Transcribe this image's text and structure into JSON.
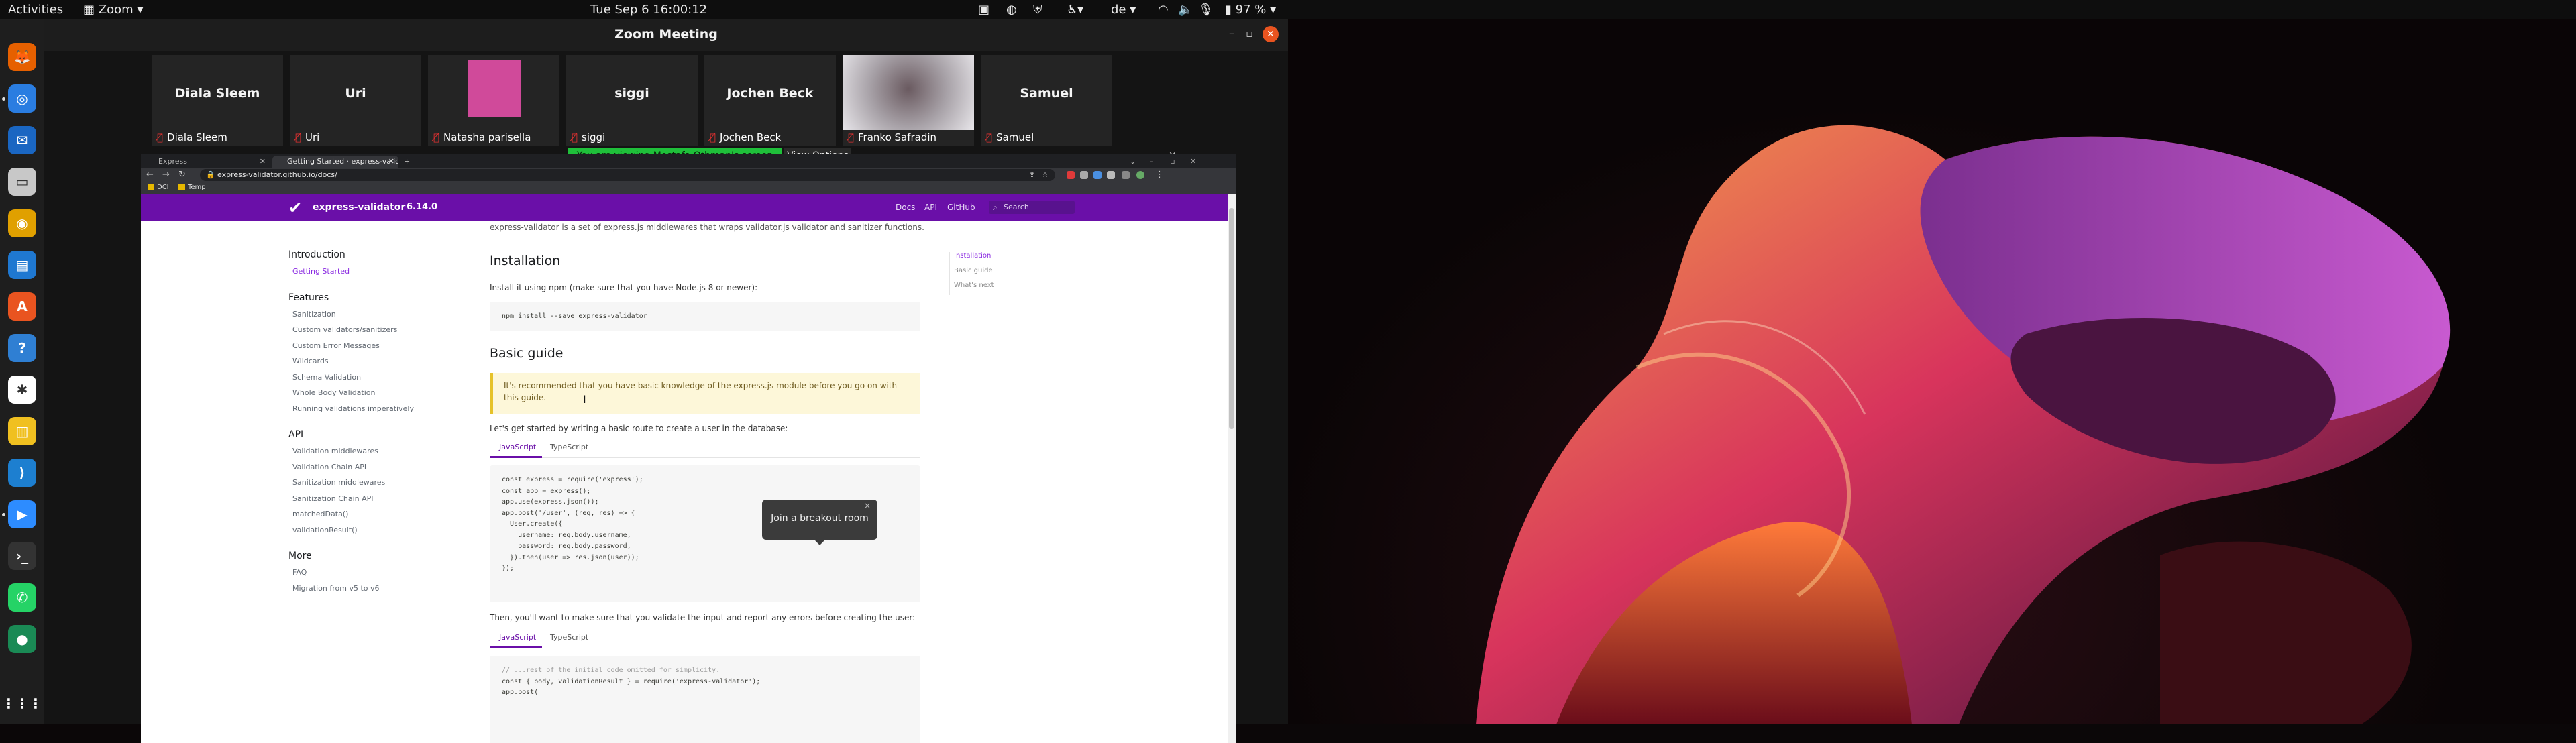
{
  "topbar": {
    "activities": "Activities",
    "app_menu": "Zoom",
    "clock": "Tue Sep 6  16:00:12",
    "keyboard_layout": "de",
    "battery": "97 %"
  },
  "dock": {
    "apps": [
      {
        "icon": "firefox-icon",
        "color": "#e66000",
        "glyph": "🦊"
      },
      {
        "icon": "chrome-icon",
        "color": "#2a7de1",
        "glyph": "◎"
      },
      {
        "icon": "thunderbird-icon",
        "color": "#1a66c2",
        "glyph": "✉"
      },
      {
        "icon": "files-icon",
        "color": "#c8c8c8",
        "glyph": "▭"
      },
      {
        "icon": "rhythmbox-icon",
        "color": "#e0a000",
        "glyph": "◉"
      },
      {
        "icon": "writer-icon",
        "color": "#1f78d1",
        "glyph": "▤"
      },
      {
        "icon": "software-icon",
        "color": "#e95420",
        "glyph": "A"
      },
      {
        "icon": "help-icon",
        "color": "#2f7fd3",
        "glyph": "?"
      },
      {
        "icon": "slack-icon",
        "color": "#ffffff",
        "glyph": "✱"
      },
      {
        "icon": "notes-icon",
        "color": "#f0c020",
        "glyph": "▥"
      },
      {
        "icon": "vscode-icon",
        "color": "#1d7fd0",
        "glyph": "⟩"
      },
      {
        "icon": "zoom-icon",
        "color": "#2d8cff",
        "glyph": "▶"
      },
      {
        "icon": "terminal-icon",
        "color": "#333333",
        "glyph": "›_"
      },
      {
        "icon": "whatsapp-icon",
        "color": "#25d366",
        "glyph": "✆"
      },
      {
        "icon": "gnome-icon",
        "color": "#1a8a55",
        "glyph": "●"
      }
    ],
    "show_apps_icon": "grid-icon"
  },
  "zoom": {
    "window_title": "Zoom Meeting",
    "participants": [
      {
        "display": "Diala Sleem",
        "label": "Diala Sleem",
        "avatar": false
      },
      {
        "display": "Uri",
        "label": "Uri",
        "avatar": false
      },
      {
        "display": "",
        "label": "Natasha parisella",
        "avatar": true,
        "avatar_color": "#d04a9a"
      },
      {
        "display": "siggi",
        "label": "siggi",
        "avatar": false
      },
      {
        "display": "Jochen Beck",
        "label": "Jochen Beck",
        "avatar": false
      },
      {
        "display": "",
        "label": "Franko Safradin",
        "avatar": true,
        "avatar_color": "#8a7a86"
      },
      {
        "display": "Samuel",
        "label": "Samuel",
        "avatar": false
      }
    ],
    "share_banner": "You are viewing Mostafa Othman's screen",
    "view_options": "View Options",
    "breakout_popup": "Join a breakout room"
  },
  "browser": {
    "tabs": [
      {
        "title": "Express",
        "active": false
      },
      {
        "title": "Getting Started · express-validat",
        "active": true
      }
    ],
    "url": "express-validator.github.io/docs/",
    "bookmarks": [
      "DCI",
      "Temp"
    ]
  },
  "site": {
    "brand": "express-validator",
    "version": "6.14.0",
    "nav": [
      "Docs",
      "API",
      "GitHub"
    ],
    "search_placeholder": "Search",
    "intro_line": "express-validator is a set of express.js middlewares that wraps validator.js validator and sanitizer functions.",
    "sidebar": [
      {
        "heading": "Introduction",
        "items": [
          {
            "label": "Getting Started",
            "active": true
          }
        ]
      },
      {
        "heading": "Features",
        "items": [
          {
            "label": "Sanitization"
          },
          {
            "label": "Custom validators/sanitizers"
          },
          {
            "label": "Custom Error Messages"
          },
          {
            "label": "Wildcards"
          },
          {
            "label": "Schema Validation"
          },
          {
            "label": "Whole Body Validation"
          },
          {
            "label": "Running validations imperatively"
          }
        ]
      },
      {
        "heading": "API",
        "items": [
          {
            "label": "Validation middlewares"
          },
          {
            "label": "Validation Chain API"
          },
          {
            "label": "Sanitization middlewares"
          },
          {
            "label": "Sanitization Chain API"
          },
          {
            "label": "matchedData()"
          },
          {
            "label": "validationResult()"
          }
        ]
      },
      {
        "heading": "More",
        "items": [
          {
            "label": "FAQ"
          },
          {
            "label": "Migration from v5 to v6"
          }
        ]
      }
    ],
    "toc": [
      {
        "label": "Installation",
        "active": true
      },
      {
        "label": "Basic guide"
      },
      {
        "label": "What's next"
      }
    ],
    "installation": {
      "heading": "Installation",
      "text": "Install it using npm (make sure that you have Node.js 8 or newer):",
      "command": "npm install --save express-validator"
    },
    "basic_guide": {
      "heading": "Basic guide",
      "tip": "It's recommended that you have basic knowledge of the express.js module before you go on with this guide.",
      "intro": "Let's get started by writing a basic route to create a user in the database:",
      "tab_js": "JavaScript",
      "tab_ts": "TypeScript",
      "code1": [
        "const express = require('express');",
        "const app = express();",
        "",
        "app.use(express.json());",
        "app.post('/user', (req, res) => {",
        "  User.create({",
        "    username: req.body.username,",
        "    password: req.body.password,",
        "  }).then(user => res.json(user));",
        "});"
      ],
      "after": "Then, you'll want to make sure that you validate the input and report any errors before creating the user:",
      "code2": [
        "// ...rest of the initial code omitted for simplicity.",
        "const { body, validationResult } = require('express-validator');",
        "",
        "app.post("
      ]
    }
  }
}
